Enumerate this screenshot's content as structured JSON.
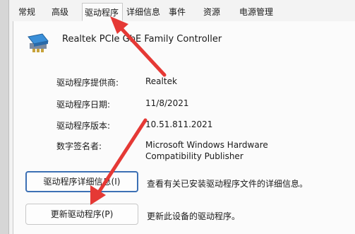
{
  "tabs": [
    {
      "label": "常规"
    },
    {
      "label": "高级"
    },
    {
      "label": "驱动程序"
    },
    {
      "label": "详细信息"
    },
    {
      "label": "事件"
    },
    {
      "label": "资源"
    },
    {
      "label": "电源管理"
    }
  ],
  "active_tab": "驱动程序",
  "device": {
    "name": "Realtek PCIe GbE Family Controller",
    "icon": "network-adapter-icon"
  },
  "properties": {
    "provider": {
      "label": "驱动程序提供商:",
      "value": "Realtek"
    },
    "date": {
      "label": "驱动程序日期:",
      "value": "11/8/2021"
    },
    "version": {
      "label": "驱动程序版本:",
      "value": "10.51.811.2021"
    },
    "signer": {
      "label": "数字签名者:",
      "value_line1": "Microsoft Windows Hardware",
      "value_line2": "Compatibility Publisher"
    }
  },
  "buttons": {
    "driver_details": {
      "label": "驱动程序详细信息(I)",
      "desc": "查看有关已安装驱动程序文件的详细信息。"
    },
    "update_driver": {
      "label": "更新驱动程序(P)",
      "desc": "更新此设备的驱动程序。"
    }
  },
  "colors": {
    "annotation_arrow": "#e53935",
    "button_focus_border": "#3c70b4"
  }
}
